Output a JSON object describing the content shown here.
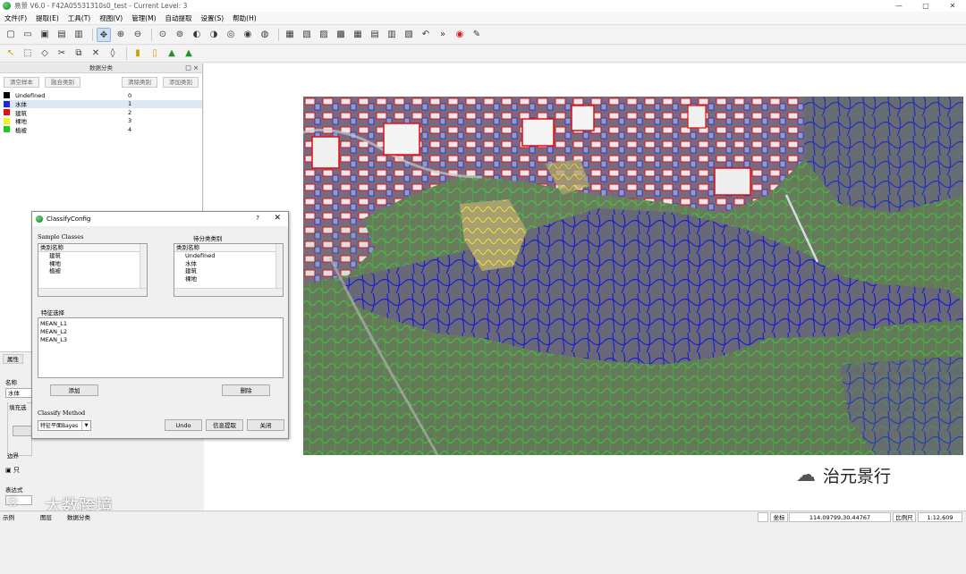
{
  "window": {
    "title": "易景 V6.0 - F42A05531310s0_test - Current Level: 3",
    "controls": [
      "—",
      "▢",
      "✕"
    ]
  },
  "menu": [
    "文件(F)",
    "提取(E)",
    "工具(T)",
    "视图(V)",
    "管理(M)",
    "自动提取",
    "设置(S)",
    "帮助(H)"
  ],
  "toolbar1_icons": [
    "new-file",
    "open-folder",
    "save",
    "save-as",
    "print",
    "pan",
    "zoom-in",
    "zoom-out",
    "zoom-box",
    "zoom-full",
    "zoom-prev",
    "zoom-next",
    "zoom-layer",
    "zoom-select",
    "zoom-extent",
    "layer-add",
    "layer-list",
    "raster",
    "vector",
    "grid",
    "grid2",
    "attribute",
    "marker",
    "undo",
    "more",
    "help",
    "pin"
  ],
  "toolbar2_icons": [
    "select-arrow",
    "select-area",
    "edit-vertex",
    "split",
    "merge",
    "delete",
    "reshape",
    "chart",
    "classify",
    "classify2",
    "sample"
  ],
  "classpanel": {
    "title": "数据分类",
    "close_icon": "□ ×",
    "left_buttons": [
      "清空样本",
      "融合类别"
    ],
    "right_buttons": [
      "清除类别",
      "添加类别"
    ],
    "classes": [
      {
        "name": "Undefined",
        "id": "0",
        "color": "#000000"
      },
      {
        "name": "水体",
        "id": "1",
        "color": "#1d2ad8"
      },
      {
        "name": "建筑",
        "id": "2",
        "color": "#e01010"
      },
      {
        "name": "裸地",
        "id": "3",
        "color": "#f2f21a"
      },
      {
        "name": "植被",
        "id": "4",
        "color": "#20c820"
      }
    ]
  },
  "lowerpanel": {
    "tab": "属性",
    "name_label": "名称",
    "name_value": "水体",
    "fill_label": "填充选",
    "border_label": "边界",
    "only_label": "只",
    "expr_label": "表达式"
  },
  "dialog": {
    "title": "ClassifyConfig",
    "help": "?",
    "close": "✕",
    "sample_label": "Sample Classes",
    "target_label": "待分类类别",
    "sample_header": "类别名称",
    "sample_items": [
      "建筑",
      "裸地",
      "植被"
    ],
    "target_header": "类别名称",
    "target_items": [
      "Undefined",
      "水体",
      "建筑",
      "裸地"
    ],
    "feature_label": "特征选择",
    "features": [
      "MEAN_L1",
      "MEAN_L2",
      "MEAN_L3"
    ],
    "add_button": "添加",
    "delete_button": "删除",
    "method_label": "Classify Method",
    "method_value": "特征平面Bayes",
    "undo_button": "Undo",
    "extract_button": "信息提取",
    "close_button": "关闭"
  },
  "statusbar": {
    "coord_label": "坐标",
    "coord_value": "114.09799,30.44767",
    "scale_label": "比例尺",
    "scale_value": "1:12,609",
    "left_items": [
      "示例",
      "图层",
      "数据分类"
    ]
  },
  "watermarks": {
    "left": "大数跨境",
    "right": "治元景行"
  }
}
